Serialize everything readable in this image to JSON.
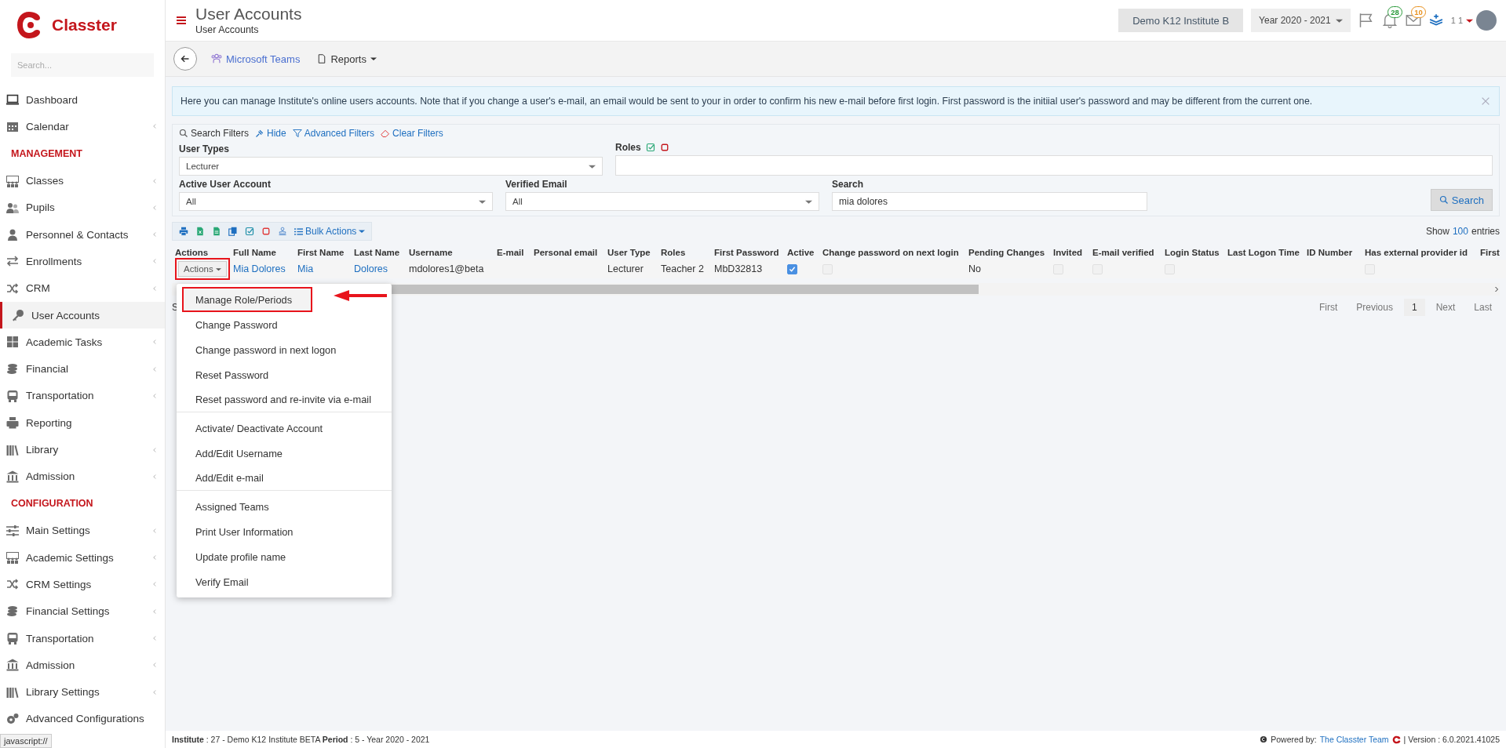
{
  "sidebar": {
    "brand": "Classter",
    "search_placeholder": "Search...",
    "items": [
      {
        "kind": "item",
        "label": "Dashboard",
        "selected": false,
        "has_submenu": false
      },
      {
        "kind": "item",
        "label": "Calendar",
        "selected": false,
        "has_submenu": true
      },
      {
        "kind": "section",
        "label": "MANAGEMENT"
      },
      {
        "kind": "item",
        "label": "Classes",
        "selected": false,
        "has_submenu": true
      },
      {
        "kind": "item",
        "label": "Pupils",
        "selected": false,
        "has_submenu": true
      },
      {
        "kind": "item",
        "label": "Personnel & Contacts",
        "selected": false,
        "has_submenu": true
      },
      {
        "kind": "item",
        "label": "Enrollments",
        "selected": false,
        "has_submenu": true
      },
      {
        "kind": "item",
        "label": "CRM",
        "selected": false,
        "has_submenu": true
      },
      {
        "kind": "item",
        "label": "User Accounts",
        "selected": true,
        "has_submenu": false
      },
      {
        "kind": "item",
        "label": "Academic Tasks",
        "selected": false,
        "has_submenu": true
      },
      {
        "kind": "item",
        "label": "Financial",
        "selected": false,
        "has_submenu": true
      },
      {
        "kind": "item",
        "label": "Transportation",
        "selected": false,
        "has_submenu": true
      },
      {
        "kind": "item",
        "label": "Reporting",
        "selected": false,
        "has_submenu": false
      },
      {
        "kind": "item",
        "label": "Library",
        "selected": false,
        "has_submenu": true
      },
      {
        "kind": "item",
        "label": "Admission",
        "selected": false,
        "has_submenu": true
      },
      {
        "kind": "section",
        "label": "CONFIGURATION"
      },
      {
        "kind": "item",
        "label": "Main Settings",
        "selected": false,
        "has_submenu": true
      },
      {
        "kind": "item",
        "label": "Academic Settings",
        "selected": false,
        "has_submenu": true
      },
      {
        "kind": "item",
        "label": "CRM Settings",
        "selected": false,
        "has_submenu": true
      },
      {
        "kind": "item",
        "label": "Financial Settings",
        "selected": false,
        "has_submenu": true
      },
      {
        "kind": "item",
        "label": "Transportation",
        "selected": false,
        "has_submenu": true
      },
      {
        "kind": "item",
        "label": "Admission",
        "selected": false,
        "has_submenu": true
      },
      {
        "kind": "item",
        "label": "Library Settings",
        "selected": false,
        "has_submenu": true
      },
      {
        "kind": "item",
        "label": "Advanced Configurations",
        "selected": false,
        "has_submenu": false
      }
    ]
  },
  "header": {
    "title": "User Accounts",
    "breadcrumb": "User Accounts",
    "institute": "Demo K12 Institute B",
    "year": "Year 2020 - 2021",
    "notifications_count": "28",
    "messages_count": "10",
    "user_label": "1 1"
  },
  "toolbar": {
    "teams": "Microsoft Teams",
    "reports": "Reports"
  },
  "info": {
    "text": "Here you can manage Institute's online users accounts. Note that if you change a user's e-mail, an email would be sent to your in order to confirm his new e-mail before first login. First password is the initiial user's password and may be different from the current one."
  },
  "filters": {
    "links": [
      {
        "kind": "search",
        "label": "Search Filters"
      },
      {
        "kind": "hide",
        "label": "Hide"
      },
      {
        "kind": "advanced",
        "label": "Advanced Filters"
      },
      {
        "kind": "clear",
        "label": "Clear Filters"
      }
    ],
    "user_types": {
      "label": "User Types",
      "value": "Lecturer"
    },
    "roles": {
      "label": "Roles"
    },
    "active_account": {
      "label": "Active User Account",
      "value": "All"
    },
    "verified_email": {
      "label": "Verified Email",
      "value": "All"
    },
    "search": {
      "label": "Search",
      "value": "mia dolores"
    },
    "search_button": "Search"
  },
  "table": {
    "bulk_actions": "Bulk Actions",
    "show_label": "Show",
    "page_size": "100",
    "entries_label": "entries",
    "columns": [
      "Actions",
      "Full Name",
      "First Name",
      "Last Name",
      "Username",
      "E-mail",
      "Personal email",
      "User Type",
      "Roles",
      "First Password",
      "Active",
      "Change password on next login",
      "Pending Changes",
      "Invited",
      "E-mail verified",
      "Login Status",
      "Last Logon Time",
      "ID Number",
      "Has external provider id",
      "First"
    ],
    "rows": [
      {
        "cells": [
          {
            "kind": "actions",
            "text": "Actions",
            "annotated": true
          },
          {
            "kind": "link",
            "text": "Mia Dolores"
          },
          {
            "kind": "link",
            "text": "Mia"
          },
          {
            "kind": "link",
            "text": "Dolores"
          },
          {
            "kind": "text",
            "text": "mdolores1@beta"
          },
          {
            "kind": "empty"
          },
          {
            "kind": "empty"
          },
          {
            "kind": "text",
            "text": "Lecturer"
          },
          {
            "kind": "text",
            "text": "Teacher 2"
          },
          {
            "kind": "text",
            "text": "MbD32813"
          },
          {
            "kind": "checkbox",
            "checked": true,
            "disabled": false
          },
          {
            "kind": "checkbox",
            "checked": false,
            "disabled": true
          },
          {
            "kind": "text",
            "text": "No"
          },
          {
            "kind": "checkbox",
            "checked": false,
            "disabled": true
          },
          {
            "kind": "checkbox",
            "checked": false,
            "disabled": true
          },
          {
            "kind": "checkbox",
            "checked": false,
            "disabled": true
          },
          {
            "kind": "empty"
          },
          {
            "kind": "empty"
          },
          {
            "kind": "checkbox",
            "checked": false,
            "disabled": true
          },
          {
            "kind": "empty"
          }
        ]
      }
    ],
    "info_text": "S",
    "pager": [
      {
        "label": "First",
        "selected": false
      },
      {
        "label": "Previous",
        "selected": false
      },
      {
        "label": "1",
        "selected": true
      },
      {
        "label": "Next",
        "selected": false
      },
      {
        "label": "Last",
        "selected": false
      }
    ],
    "menu": [
      {
        "label": "Manage Role/Periods",
        "annotated": true,
        "divider_after": false
      },
      {
        "label": "Change Password",
        "annotated": false,
        "divider_after": false
      },
      {
        "label": "Change password in next logon",
        "annotated": false,
        "divider_after": false
      },
      {
        "label": "Reset Password",
        "annotated": false,
        "divider_after": false
      },
      {
        "label": "Reset password and re-invite via e-mail",
        "annotated": false,
        "divider_after": true
      },
      {
        "label": "Activate/ Deactivate Account",
        "annotated": false,
        "divider_after": false
      },
      {
        "label": "Add/Edit Username",
        "annotated": false,
        "divider_after": false
      },
      {
        "label": "Add/Edit e-mail",
        "annotated": false,
        "divider_after": true
      },
      {
        "label": "Assigned Teams",
        "annotated": false,
        "divider_after": false
      },
      {
        "label": "Print User Information",
        "annotated": false,
        "divider_after": false
      },
      {
        "label": "Update profile name",
        "annotated": false,
        "divider_after": false
      },
      {
        "label": "Verify Email",
        "annotated": false,
        "divider_after": false
      }
    ]
  },
  "footer": {
    "institute_info": "**Institute** : 27 - Demo K12 Institute BETA **Period** : 5 - Year 2020 - 2021",
    "powered_by": "Powered by:",
    "team_link": "The Classter Team",
    "version": "| Version : 6.0.2021.41025"
  },
  "browser_status": "javascript://"
}
